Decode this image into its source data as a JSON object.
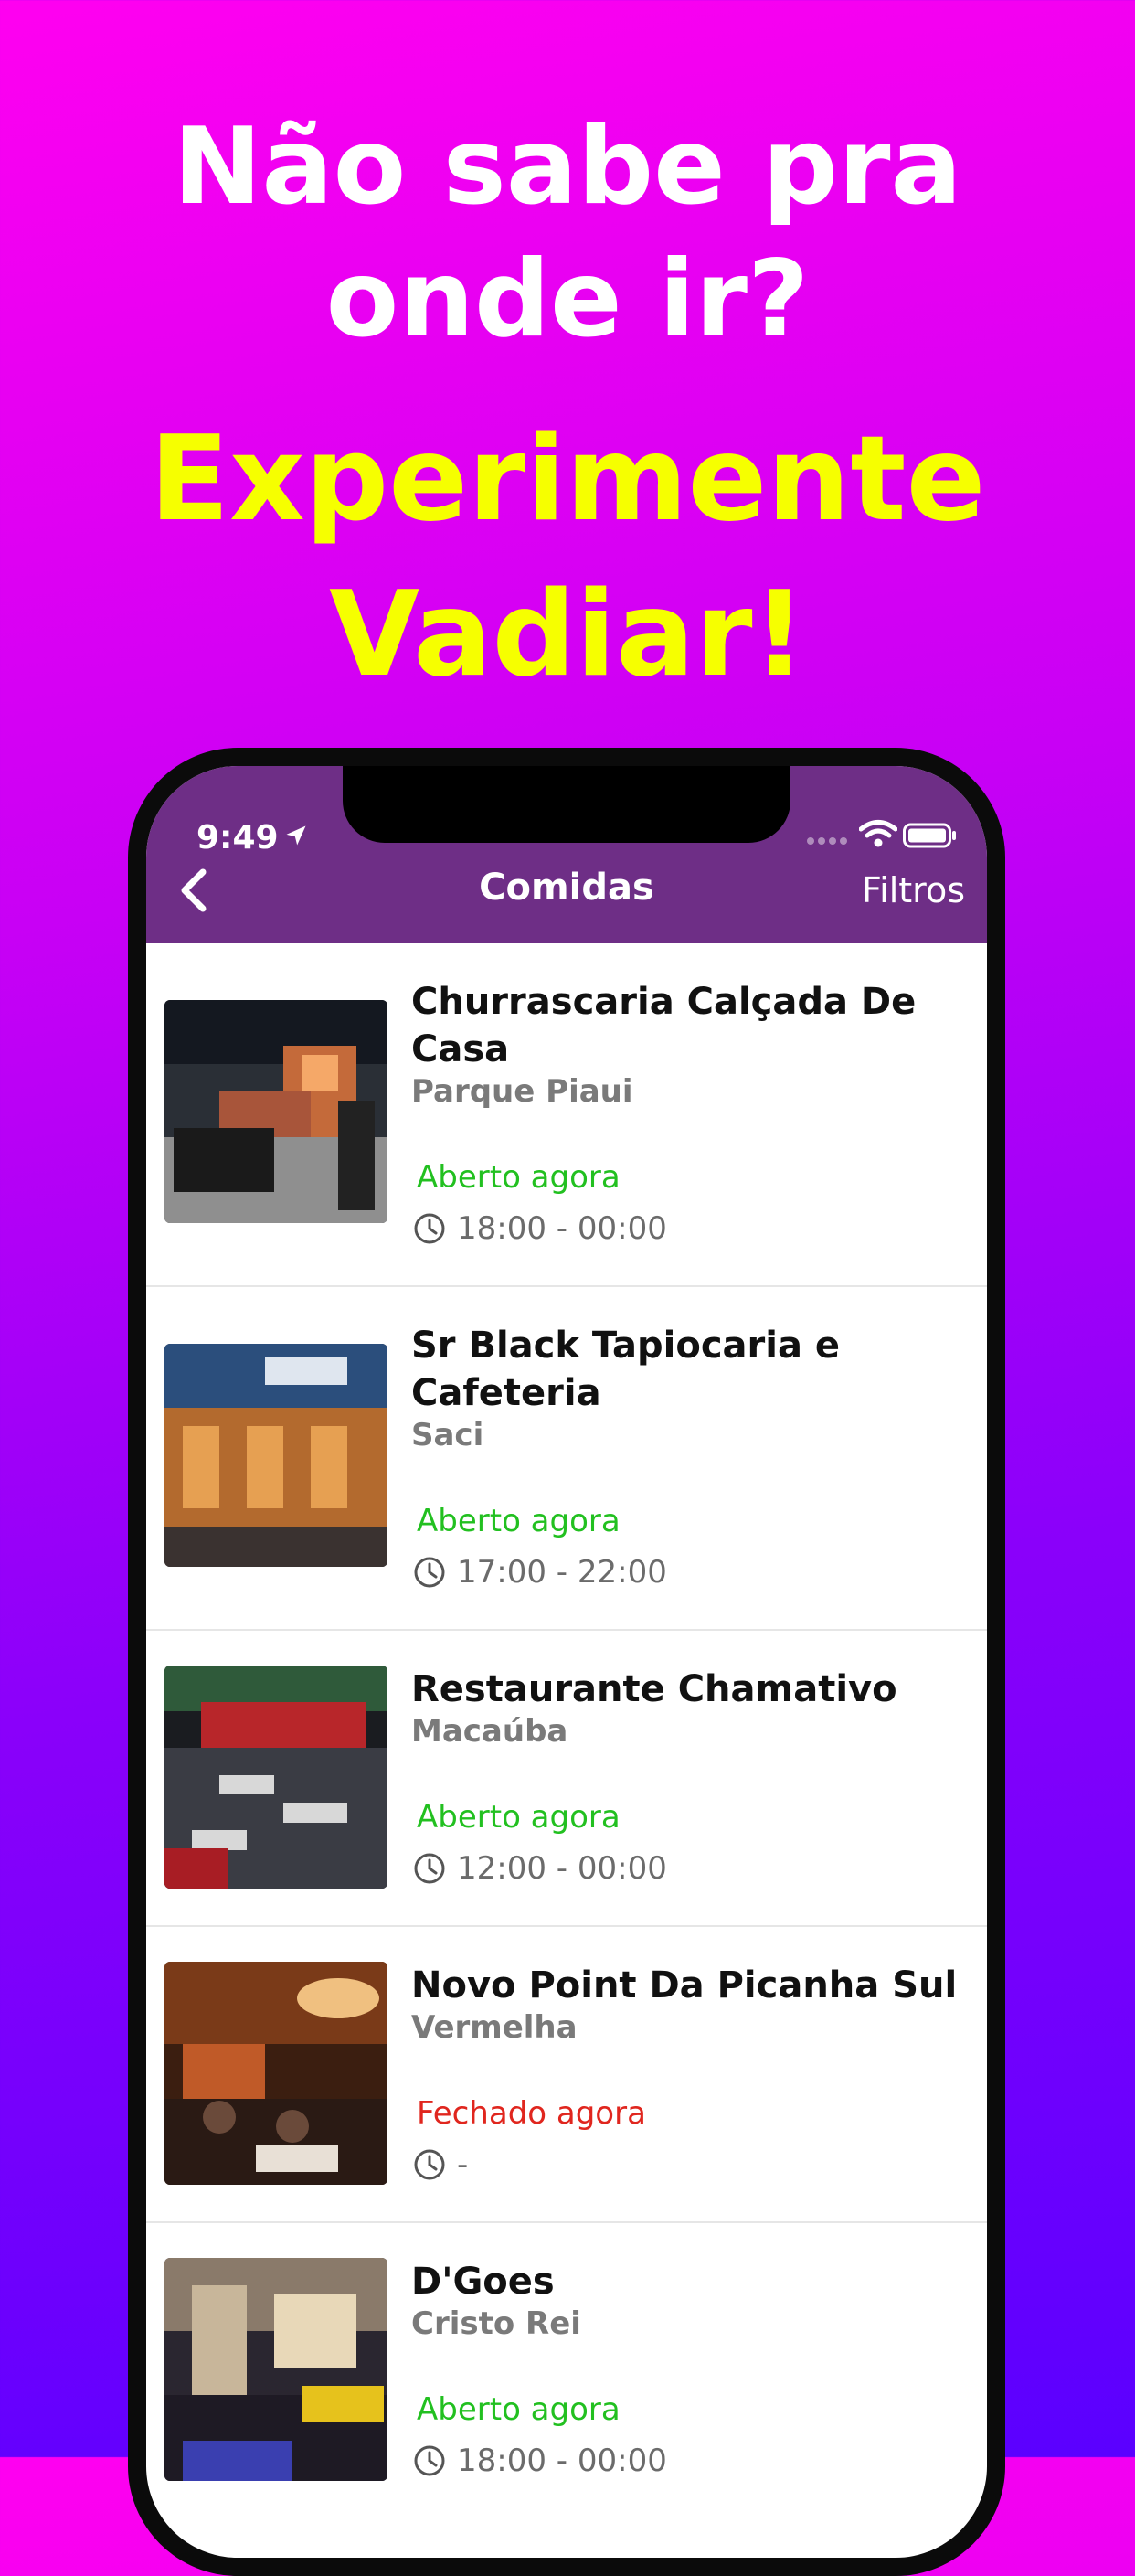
{
  "promo": {
    "line1a": "Não sabe pra",
    "line1b": "onde ir?",
    "line2a": "Experimente",
    "line2b": "Vadiar!"
  },
  "status_bar": {
    "time": "9:49"
  },
  "navbar": {
    "title": "Comidas",
    "filter_label": "Filtros"
  },
  "colors": {
    "navbar": "#6e2e86",
    "open": "#22c020",
    "closed": "#e0261e",
    "promo_white": "#ffffff",
    "promo_yellow": "#f6ff00"
  },
  "restaurants": [
    {
      "name_line1": "Churrascaria Calçada De",
      "name_line2": "Casa",
      "neighborhood": "Parque Piaui",
      "status": "Aberto agora",
      "hours": "18:00 - 00:00"
    },
    {
      "name_line1": "Sr Black Tapiocaria e",
      "name_line2": "Cafeteria",
      "neighborhood": "Saci",
      "status": "Aberto agora",
      "hours": "17:00 - 22:00"
    },
    {
      "name_line1": "Restaurante Chamativo",
      "neighborhood": "Macaúba",
      "status": "Aberto agora",
      "hours": "12:00 - 00:00"
    },
    {
      "name_line1": "Novo Point Da Picanha Sul",
      "neighborhood": "Vermelha",
      "status": "Fechado agora",
      "hours": "-"
    },
    {
      "name_line1": "D'Goes",
      "neighborhood": "Cristo Rei",
      "status": "Aberto agora",
      "hours": "18:00 - 00:00"
    }
  ]
}
